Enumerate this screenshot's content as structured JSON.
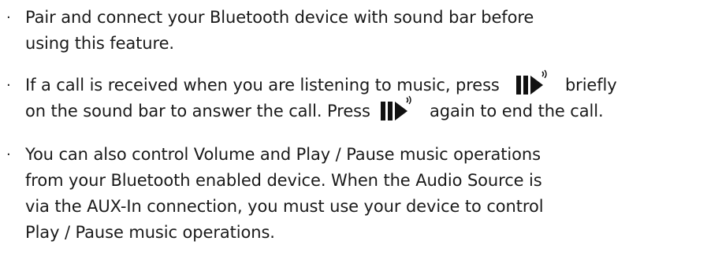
{
  "instructions": {
    "bullet_glyph": "·",
    "item1": {
      "line1": "Pair and connect your Bluetooth device with sound bar before",
      "line2": "using this feature."
    },
    "item2": {
      "line1_pre": "If a call is received when you are listening to music, press",
      "line1_post": "briefly",
      "line2_pre": "on the sound bar to answer the call. Press",
      "line2_post": "again to end the call."
    },
    "item3": {
      "line1": "You can also control Volume and Play / Pause music operations",
      "line2": "from your Bluetooth enabled device. When the Audio Source is",
      "line3": "via the AUX-In connection, you must use your device to control",
      "line4": "Play / Pause music operations."
    },
    "icons": {
      "play_pause_call": "play-pause-call-icon"
    }
  }
}
